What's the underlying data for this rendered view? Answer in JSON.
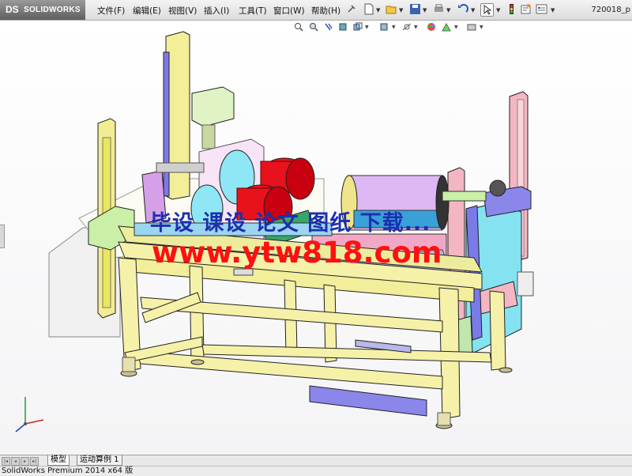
{
  "app": {
    "logo_mark": "DS",
    "logo_text": "SOLIDWORKS",
    "document_title": "720018_p"
  },
  "menu": [
    {
      "id": "file",
      "label": "文件(F)"
    },
    {
      "id": "edit",
      "label": "编辑(E)"
    },
    {
      "id": "view",
      "label": "视图(V)"
    },
    {
      "id": "insert",
      "label": "插入(I)"
    },
    {
      "id": "tools",
      "label": "工具(T)"
    },
    {
      "id": "window",
      "label": "窗口(W)"
    },
    {
      "id": "help",
      "label": "帮助(H)"
    }
  ],
  "toolbar_icons": [
    "pin-icon",
    "new-document-icon",
    "open-folder-icon",
    "save-icon",
    "print-icon",
    "undo-icon",
    "select-arrow-icon",
    "rebuild-traffic-light-icon",
    "file-properties-icon",
    "options-icon"
  ],
  "heads_up_icons": [
    "zoom-to-fit-icon",
    "zoom-to-area-icon",
    "previous-view-icon",
    "section-view-icon",
    "view-orientation-icon",
    "display-style-icon",
    "hide-show-items-icon",
    "edit-appearance-icon",
    "apply-scene-icon",
    "view-settings-icon"
  ],
  "watermark": {
    "line1": "毕设 课设 论文 图纸 下载...",
    "line2": "www.ytw818.com"
  },
  "tabs": [
    {
      "id": "model",
      "label": "模型",
      "active": true
    },
    {
      "id": "motion-study",
      "label": "运动算例 1",
      "active": false
    }
  ],
  "status_text": "SolidWorks Premium 2014 x64 版",
  "colors": {
    "frame_yellow": "#f4f0a6",
    "motor_red": "#e8101c",
    "roller_purple": "#d9b6f2",
    "panel_cyan": "#7fe0f0",
    "plate_pink": "#f7b6c4",
    "plate_purple": "#8080e8",
    "watermark_blue": "#1c2fb0",
    "watermark_red": "#ff1010"
  }
}
